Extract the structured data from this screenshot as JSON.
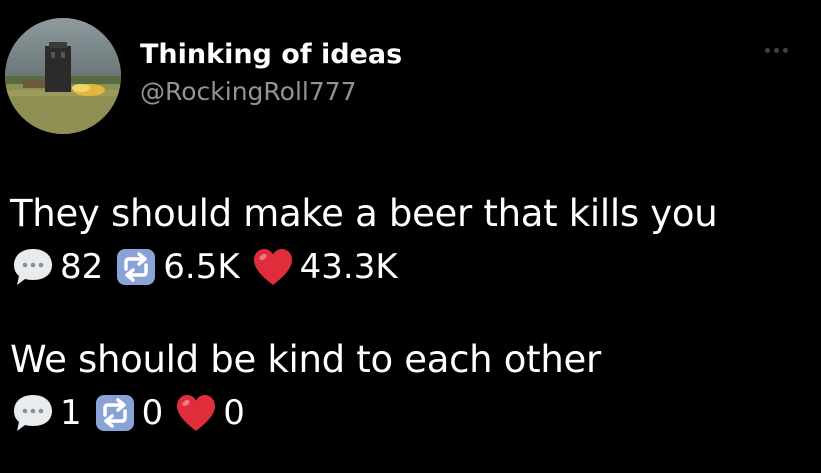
{
  "profile": {
    "display_name": "Thinking of ideas",
    "handle": "@RockingRoll777",
    "avatar_icon": "avatar-photo",
    "more_icon": "more-options-icon"
  },
  "tweets": [
    {
      "text": "They should make a beer that kills you",
      "replies": "82",
      "retweets": "6.5K",
      "likes": "43.3K"
    },
    {
      "text": "We should be kind to each other",
      "replies": "1",
      "retweets": "0",
      "likes": "0"
    }
  ],
  "icons": {
    "reply": "speech-bubble-icon",
    "retweet": "repeat-icon",
    "like": "red-heart-icon"
  },
  "colors": {
    "background": "#000000",
    "text": "#ffffff",
    "handle": "#8f9498",
    "heart": "#e02d3c",
    "retweet_box": "#8aa3d6"
  }
}
